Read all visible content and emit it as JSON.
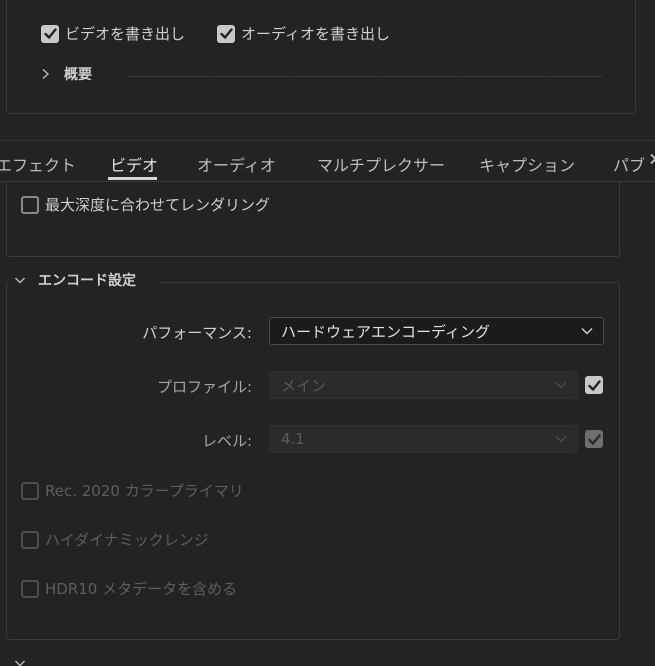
{
  "export": {
    "video_label": "ビデオを書き出し",
    "video_checked": true,
    "audio_label": "オーディオを書き出し",
    "audio_checked": true,
    "summary_label": "概要"
  },
  "tabs": [
    {
      "label": "エフェクト",
      "active": false
    },
    {
      "label": "ビデオ",
      "active": true
    },
    {
      "label": "オーディオ",
      "active": false
    },
    {
      "label": "マルチプレクサー",
      "active": false
    },
    {
      "label": "キャプション",
      "active": false
    },
    {
      "label": "パブ",
      "active": false
    }
  ],
  "video": {
    "max_depth_label": "最大深度に合わせてレンダリング",
    "max_depth_checked": false
  },
  "encode": {
    "title": "エンコード設定",
    "performance_label": "パフォーマンス:",
    "performance_value": "ハードウェアエンコーディング",
    "profile_label": "プロファイル:",
    "profile_value": "メイン",
    "profile_checked": true,
    "level_label": "レベル:",
    "level_value": "4.1",
    "level_checked": true,
    "rec2020_label": "Rec. 2020 カラープライマリ",
    "hdr_label": "ハイダイナミックレンジ",
    "hdr10_label": "HDR10 メタデータを含める"
  },
  "colors": {
    "background": "#232323",
    "border": "#3a3a3a",
    "checkbox_on": "#c8c8c8",
    "text": "#cfcfcf"
  }
}
